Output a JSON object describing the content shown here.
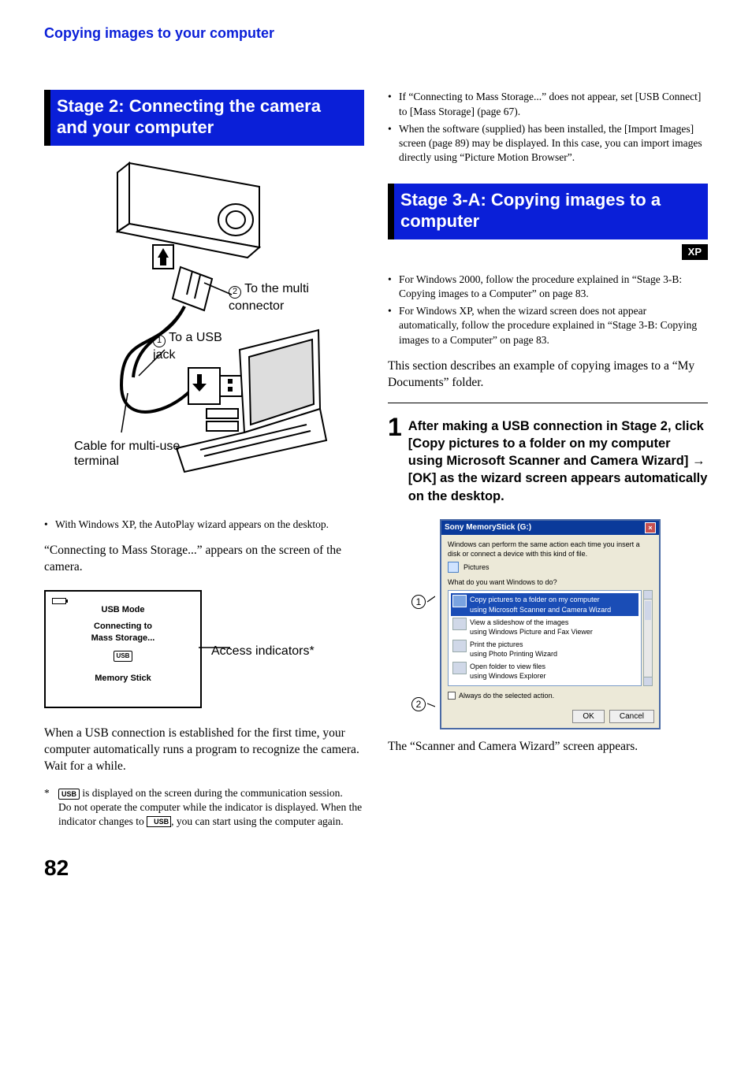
{
  "breadcrumb": "Copying images to your computer",
  "left": {
    "stage_title": "Stage 2: Connecting the camera and your computer",
    "diagram": {
      "callout2": "To the multi connector",
      "callout1": "To a USB jack",
      "cable_label": "Cable for multi-use terminal"
    },
    "bullet1": "With Windows XP, the AutoPlay wizard appears on the desktop.",
    "para1": "“Connecting to Mass Storage...” appears on the screen of the camera.",
    "lcd": {
      "line1": "USB Mode",
      "line2": "Connecting to",
      "line3": "Mass Storage...",
      "badge": "USB",
      "line4": "Memory Stick"
    },
    "access_label": "Access indicators*",
    "para2": "When a USB connection is established for the first time, your computer automatically runs a program to recognize the camera. Wait for a while.",
    "foot1a": "is displayed on the screen during the communication session.",
    "foot1b": "Do not operate the computer while the indicator is displayed. When the indicator changes to",
    "foot1c": ", you can start using the computer again.",
    "usb_small": "USB"
  },
  "right": {
    "bullets_top": [
      "If “Connecting to Mass Storage...” does not appear, set [USB Connect] to [Mass Storage] (page 67).",
      "When the software (supplied) has been installed, the [Import Images] screen (page 89) may be displayed. In this case, you can import images directly using “Picture Motion Browser”."
    ],
    "stage_title": "Stage 3-A: Copying images to a computer",
    "xp_badge": "XP",
    "bullets_mid": [
      "For Windows 2000, follow the procedure explained in “Stage 3-B: Copying images to a Computer” on page 83.",
      "For Windows XP, when the wizard screen does not appear automatically, follow the procedure explained in “Stage 3-B: Copying images to a Computer” on page 83."
    ],
    "para1": "This section describes an example of copying images to a “My Documents” folder.",
    "step1_num": "1",
    "step1_text": "After making a USB connection in Stage 2, click [Copy pictures to a folder on my computer using Microsoft Scanner and Camera Wizard] → [OK] as the wizard screen appears automatically on the desktop.",
    "dialog": {
      "title": "Sony MemoryStick (G:)",
      "lead": "Windows can perform the same action each time you insert a disk or connect a device with this kind of file.",
      "pictures": "Pictures",
      "prompt": "What do you want Windows to do?",
      "items": [
        {
          "l1": "Copy pictures to a folder on my computer",
          "l2": "using Microsoft Scanner and Camera Wizard"
        },
        {
          "l1": "View a slideshow of the images",
          "l2": "using Windows Picture and Fax Viewer"
        },
        {
          "l1": "Print the pictures",
          "l2": "using Photo Printing Wizard"
        },
        {
          "l1": "Open folder to view files",
          "l2": "using Windows Explorer"
        }
      ],
      "always": "Always do the selected action.",
      "ok": "OK",
      "cancel": "Cancel"
    },
    "para2": "The “Scanner and Camera Wizard” screen appears."
  },
  "page_num": "82"
}
